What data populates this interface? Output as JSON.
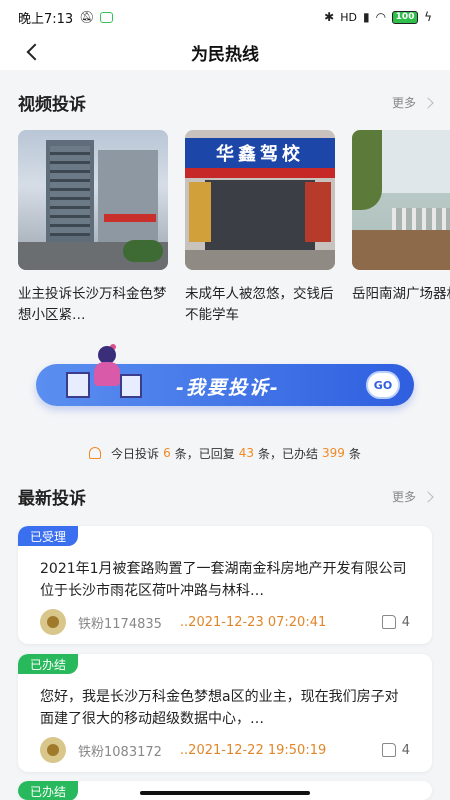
{
  "status": {
    "time": "晚上7:13",
    "network": "HD",
    "battery": "100"
  },
  "nav": {
    "title": "为民热线"
  },
  "video_section": {
    "title": "视频投诉",
    "more": "更多",
    "cards": [
      {
        "caption": "业主投诉长沙万科金色梦想小区紧…"
      },
      {
        "caption": "未成年人被忽悠，交钱后不能学车",
        "sign": "华鑫驾校"
      },
      {
        "caption": "岳阳南湖广场器材缺失"
      }
    ]
  },
  "banner": {
    "text": "-我要投诉-",
    "go": "GO"
  },
  "stats": {
    "prefix": "今日投诉",
    "complaints": "6",
    "unit1": "条，已回复",
    "replied": "43",
    "unit2": "条，已办结",
    "done": "399",
    "unit3": "条"
  },
  "latest_section": {
    "title": "最新投诉",
    "more": "更多"
  },
  "complaints": [
    {
      "status": "已受理",
      "text": "2021年1月被套路购置了一套湖南金科房地产开发有限公司位于长沙市雨花区荷叶冲路与林科…",
      "user": "铁粉1174835",
      "time": "..2021-12-23 07:20:41",
      "likes": "4"
    },
    {
      "status": "已办结",
      "text": "您好，我是长沙万科金色梦想a区的业主，现在我们房子对面建了很大的移动超级数据中心，…",
      "user": "铁粉1083172",
      "time": "..2021-12-22 19:50:19",
      "likes": "4"
    },
    {
      "status": "已办结"
    }
  ],
  "colors": {
    "accent": "#3a6ff0",
    "done": "#27b95c",
    "highlight": "#f08a24"
  }
}
